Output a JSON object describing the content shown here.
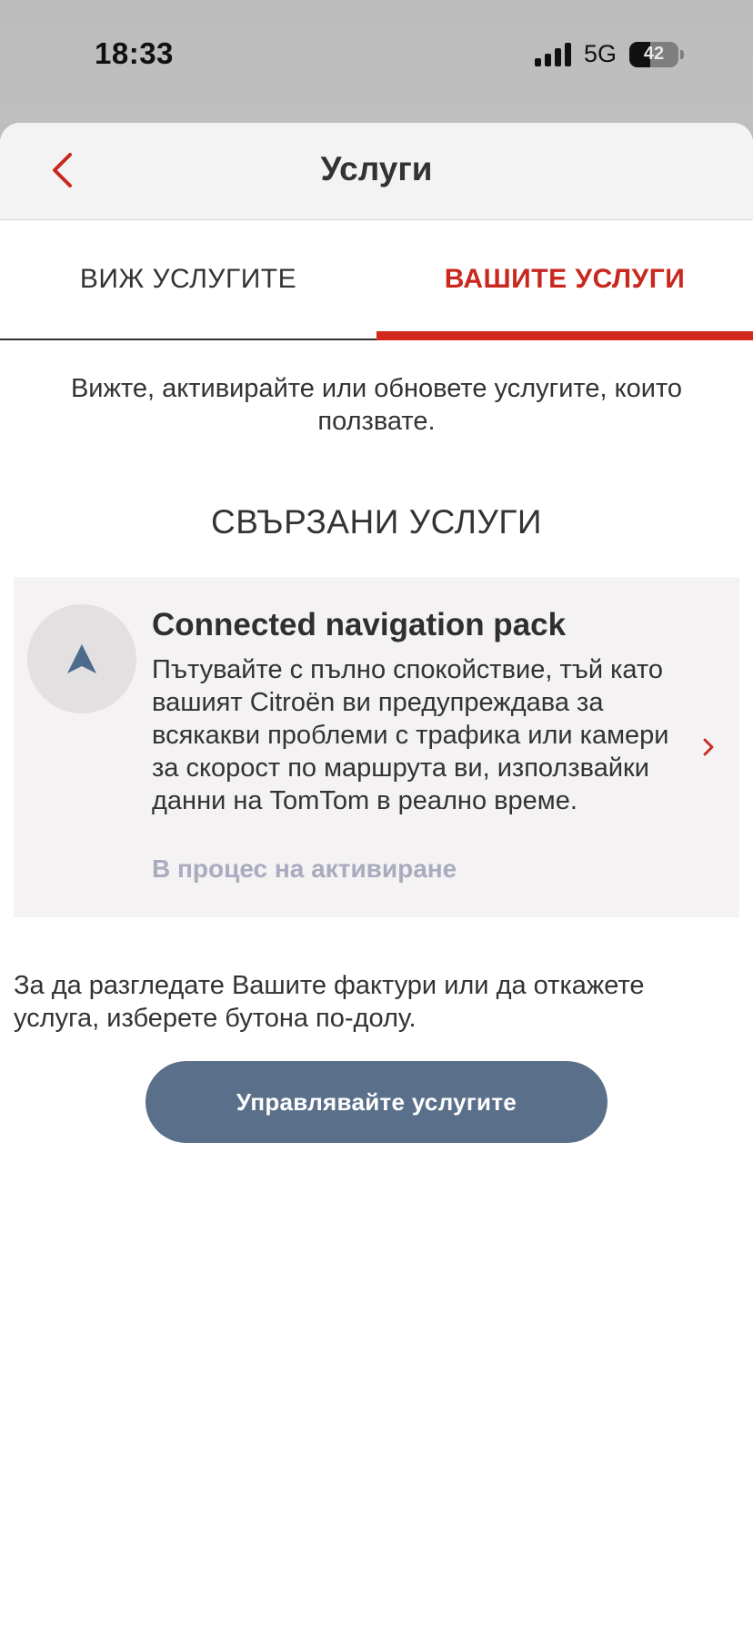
{
  "status_bar": {
    "time": "18:33",
    "network": "5G",
    "battery_level": "42",
    "battery_fraction": 0.42
  },
  "header": {
    "title": "Услуги",
    "back_icon": "chevron-left-icon"
  },
  "tabs": [
    {
      "label": "ВИЖ УСЛУГИТЕ",
      "active": false
    },
    {
      "label": "ВАШИТЕ УСЛУГИ",
      "active": true
    }
  ],
  "intro_text": "Вижте, активирайте или обновете услугите, които ползвате.",
  "section_title": "СВЪРЗАНИ УСЛУГИ",
  "service": {
    "icon": "navigation-arrow-icon",
    "name": "Connected navigation pack",
    "description": "Пътувайте с пълно спокойствие, тъй като вашият Citroën ви предупреждава за всякакви проблеми с трафика или камери за скорост по маршрута ви, използвайки данни на TomTom в реално време.",
    "status": "В процес на активиране"
  },
  "footer_text": "За да разгледате Вашите фактури или да откажете услуга, изберете бутона по-долу.",
  "manage_button_label": "Управлявайте услугите",
  "colors": {
    "accent": "#c8281e",
    "button": "#5a708a",
    "status_pending": "#a9abbf"
  }
}
